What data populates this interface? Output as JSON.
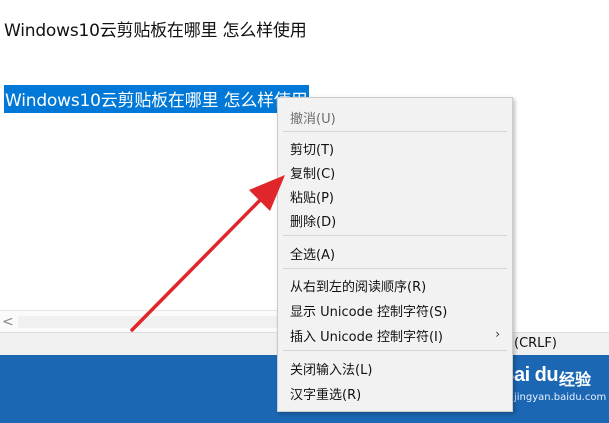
{
  "editor": {
    "line1": "Windows10云剪贴板在哪里 怎么样使用",
    "line2_selected": "Windows10云剪贴板在哪里 怎么样使用"
  },
  "scrollbar": {
    "left_arrow": "<"
  },
  "statusbar": {
    "line_ending": "(CRLF)"
  },
  "context_menu": {
    "undo": "撤消(U)",
    "cut": "剪切(T)",
    "copy": "复制(C)",
    "paste": "粘贴(P)",
    "delete": "删除(D)",
    "select_all": "全选(A)",
    "rtl": "从右到左的阅读顺序(R)",
    "show_unicode": "显示 Unicode 控制字符(S)",
    "insert_unicode": "插入 Unicode 控制字符(I)",
    "submenu_arrow": "›",
    "close_ime": "关闭输入法(L)",
    "reconvert": "汉字重选(R)"
  },
  "watermark": {
    "logo": "Bai du",
    "jingyan": "经验",
    "url": "jingyan.baidu.com"
  },
  "colors": {
    "selection": "#0078d7",
    "taskbar": "#1b67b4",
    "arrow": "#e0262b"
  }
}
